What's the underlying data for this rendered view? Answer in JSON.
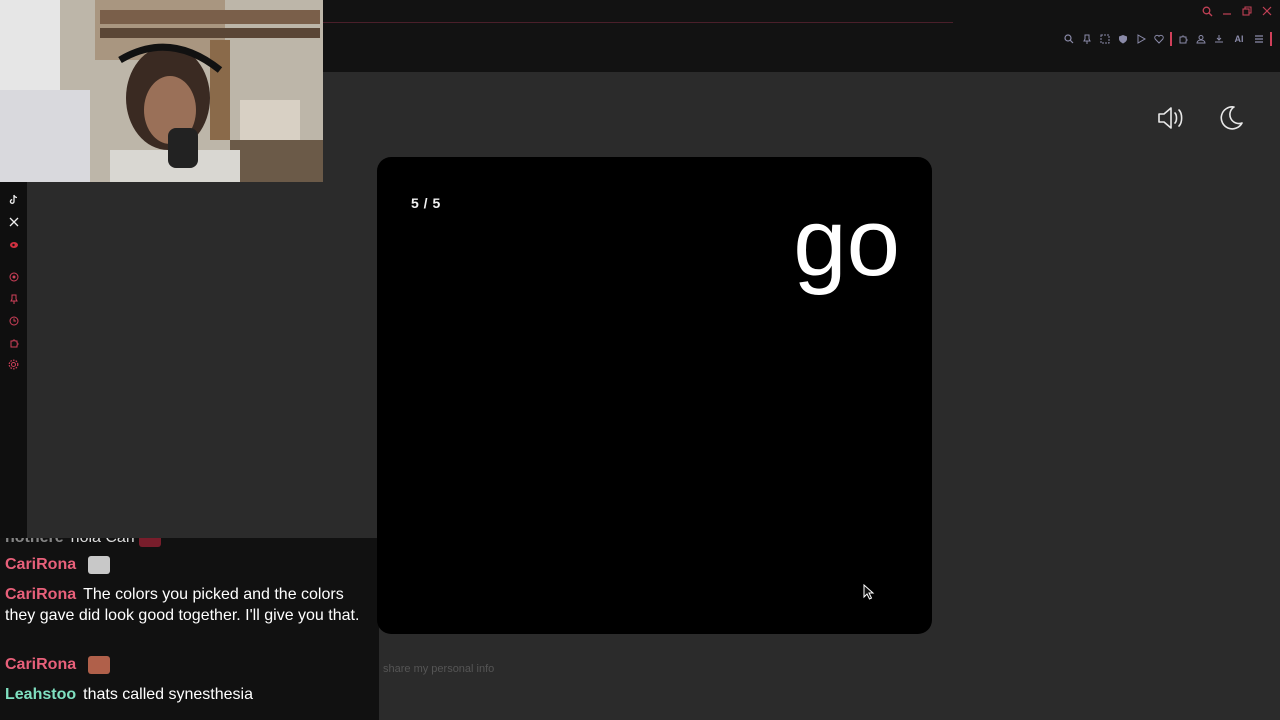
{
  "card": {
    "counter": "5 / 5",
    "word": "go"
  },
  "controls": {
    "sound": "speaker-icon",
    "theme": "moon-icon"
  },
  "footnote": "share my personal info",
  "chat": {
    "messages": [
      {
        "user": "nothere",
        "text": "hola Cari",
        "color": "#9a9a9a"
      },
      {
        "user": "CariRona",
        "text": "",
        "color": "#e8607a"
      },
      {
        "user": "CariRona",
        "text": "The colors you picked and the colors they gave did look good together. I'll give you that.",
        "color": "#e8607a"
      },
      {
        "user": "CariRona",
        "text": "",
        "color": "#e8607a"
      },
      {
        "user": "Leahstoo",
        "text": "thats called synesthesia",
        "color": "#7fe0c0"
      }
    ]
  },
  "colors": {
    "accent": "#d0405a",
    "card_bg": "#000000",
    "page_bg": "#2b2b2b"
  }
}
